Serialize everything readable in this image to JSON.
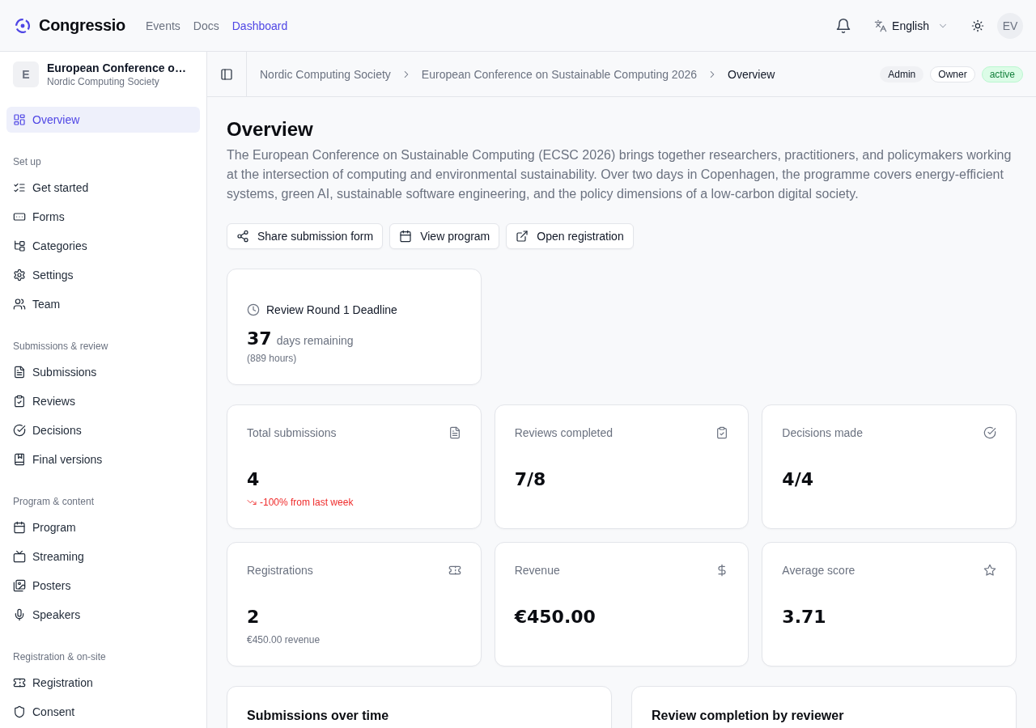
{
  "header": {
    "brand": "Congressio",
    "nav": [
      {
        "label": "Events",
        "selected": false
      },
      {
        "label": "Docs",
        "selected": false
      },
      {
        "label": "Dashboard",
        "selected": true
      }
    ],
    "language": "English",
    "avatar": "EV"
  },
  "sidebar": {
    "event": {
      "initial": "E",
      "title": "European Conference o…",
      "organization": "Nordic Computing Society"
    },
    "items": [
      {
        "label": "Overview",
        "selected": true
      }
    ],
    "sections": [
      {
        "title": "Set up",
        "items": [
          {
            "label": "Get started",
            "selected": false
          },
          {
            "label": "Forms",
            "selected": false
          },
          {
            "label": "Categories",
            "selected": false
          },
          {
            "label": "Settings",
            "selected": false
          },
          {
            "label": "Team",
            "selected": false
          }
        ]
      },
      {
        "title": "Submissions & review",
        "items": [
          {
            "label": "Submissions",
            "selected": false
          },
          {
            "label": "Reviews",
            "selected": false
          },
          {
            "label": "Decisions",
            "selected": false
          },
          {
            "label": "Final versions",
            "selected": false
          }
        ]
      },
      {
        "title": "Program & content",
        "items": [
          {
            "label": "Program",
            "selected": false
          },
          {
            "label": "Streaming",
            "selected": false
          },
          {
            "label": "Posters",
            "selected": false
          },
          {
            "label": "Speakers",
            "selected": false
          }
        ]
      },
      {
        "title": "Registration & on-site",
        "items": [
          {
            "label": "Registration",
            "selected": false
          },
          {
            "label": "Consent",
            "selected": false
          }
        ]
      }
    ]
  },
  "breadcrumbs": [
    {
      "label": "Nordic Computing Society",
      "current": false
    },
    {
      "label": "European Conference on Sustainable Computing 2026",
      "current": false
    },
    {
      "label": "Overview",
      "current": true
    }
  ],
  "badges": [
    {
      "label": "Admin",
      "kind": "muted"
    },
    {
      "label": "Owner",
      "kind": "outline"
    },
    {
      "label": "active",
      "kind": "success"
    }
  ],
  "page": {
    "title": "Overview",
    "description": "The European Conference on Sustainable Computing (ECSC 2026) brings together researchers, practitioners, and policymakers working at the intersection of computing and environmental sustainability. Over two days in Copenhagen, the programme covers energy-efficient systems, green AI, sustainable software engineering, and the policy dimensions of a low-carbon digital society.",
    "actions": [
      "Share submission form",
      "View program",
      "Open registration"
    ]
  },
  "deadline": {
    "title": "Review Round 1 Deadline",
    "value": "37",
    "unit": "days remaining",
    "detail": "(889 hours)"
  },
  "stats": [
    {
      "label": "Total submissions",
      "value": "4",
      "note": "-100% from last week",
      "negative": true
    },
    {
      "label": "Reviews completed",
      "value": "7/8"
    },
    {
      "label": "Decisions made",
      "value": "4/4"
    },
    {
      "label": "Registrations",
      "value": "2",
      "note": "€450.00 revenue"
    },
    {
      "label": "Revenue",
      "value": "€450.00"
    },
    {
      "label": "Average score",
      "value": "3.71"
    }
  ],
  "panels": [
    {
      "title": "Submissions over time"
    },
    {
      "title": "Review completion by reviewer"
    }
  ]
}
